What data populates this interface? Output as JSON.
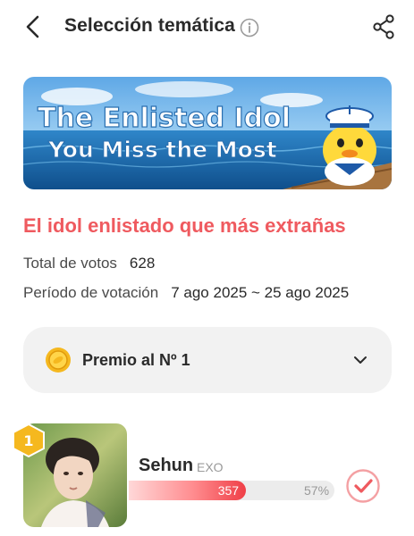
{
  "header": {
    "title": "Selección temática",
    "back_icon": "chevron-left-icon",
    "info_icon": "info-icon",
    "share_icon": "share-icon"
  },
  "banner": {
    "line1": "The Enlisted Idol",
    "line2": "You Miss the Most"
  },
  "event": {
    "title": "El idol enlistado que más extrañas",
    "votes_label": "Total de votos",
    "votes_value": "628",
    "period_label": "Período de votación",
    "period_value": "7 ago 2025 ~ 25 ago 2025"
  },
  "prize": {
    "label": "Premio al Nº 1",
    "icon": "coin-icon",
    "chevron_icon": "chevron-down-icon"
  },
  "candidate": {
    "rank": "1",
    "name": "Sehun",
    "group": "EXO",
    "votes": "357",
    "percent_label": "57%",
    "percent": 0.57,
    "check_icon": "check-circle-icon"
  },
  "colors": {
    "accent": "#ef5a5f",
    "bar_end": "#ef3f47",
    "prize_bg": "#f2f2f2",
    "gold": "#f5b81f"
  }
}
